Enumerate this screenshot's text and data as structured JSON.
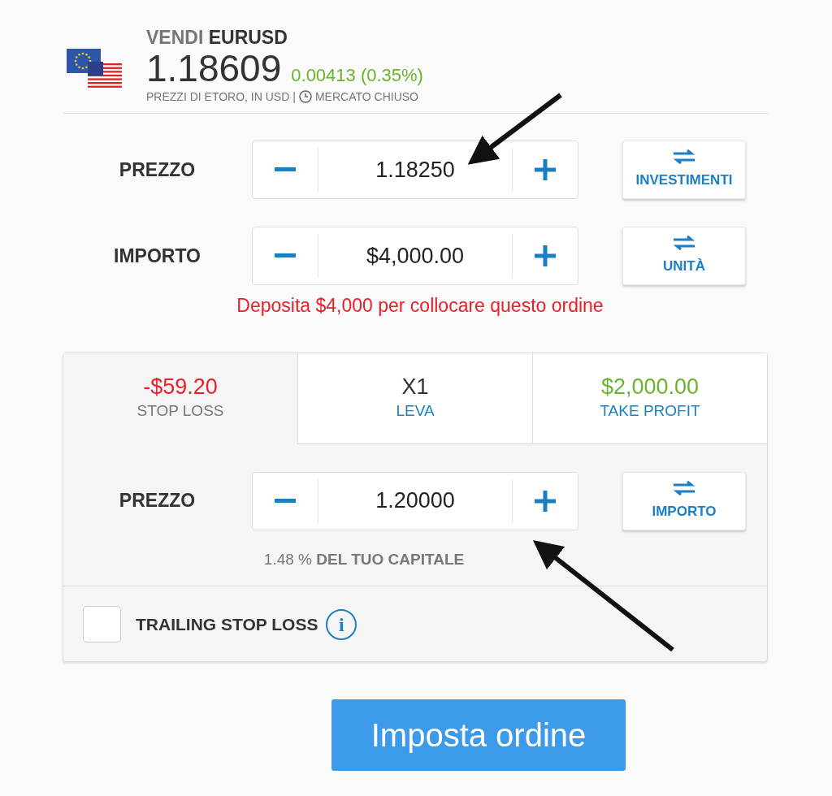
{
  "header": {
    "action": "VENDI",
    "symbol": "EURUSD",
    "price": "1.18609",
    "change": "0.00413 (0.35%)",
    "note": "PREZZI DI ETORO, IN USD",
    "separator": "|",
    "market_status": "MERCATO CHIUSO"
  },
  "order_rows": [
    {
      "label": "PREZZO",
      "value": "1.18250",
      "switch_label": "INVESTIMENTI"
    },
    {
      "label": "IMPORTO",
      "value": "$4,000.00",
      "switch_label": "UNITÀ"
    }
  ],
  "warning": "Deposita $4,000 per collocare questo ordine",
  "tabs": [
    {
      "value": "-$59.20",
      "label": "STOP LOSS",
      "selected": true,
      "color": "#e8202a"
    },
    {
      "value": "X1",
      "label": "LEVA",
      "selected": false,
      "color": "#333333"
    },
    {
      "value": "$2,000.00",
      "label": "TAKE PROFIT",
      "selected": false,
      "color": "#6ab42a"
    }
  ],
  "stop_row": {
    "label": "PREZZO",
    "value": "1.20000",
    "switch_label": "IMPORTO"
  },
  "capital_note": "1.48 % **DEL TUO CAPITALE**",
  "trailing": {
    "label": "TRAILING STOP LOSS",
    "checked": false,
    "info": "i"
  },
  "submit": "Imposta ordine"
}
